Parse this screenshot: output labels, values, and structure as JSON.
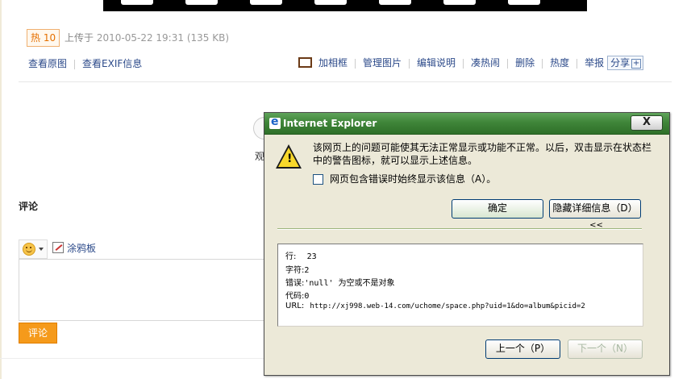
{
  "photo": {
    "hot_badge": "热 10",
    "upload_prefix": "上传于",
    "upload_time": "2010-05-22 19:31",
    "file_size": "(135 KB)"
  },
  "links_left": [
    "查看原图",
    "查看EXIF信息"
  ],
  "links_right": {
    "add_frame": "加相框",
    "manage": "管理图片",
    "edit_desc": "编辑说明",
    "join_hot": "凑热闹",
    "delete": "删除",
    "heat": "热度",
    "report": "举报",
    "share": "分享"
  },
  "background_text": "观",
  "comments": {
    "title": "评论",
    "doodle_label": "涂鸦板",
    "submit": "评论"
  },
  "dialog": {
    "title": "Internet Explorer",
    "close": "X",
    "message": "该网页上的问题可能使其无法正常显示或功能不正常。以后，双击显示在状态栏中的警告图标，就可以显示上述信息。",
    "checkbox_label": "网页包含错误时始终显示该信息（A）。",
    "ok_button": "确定",
    "hide_details_button": "隐藏详细信息（D）",
    "hide_details_chevron": "<<",
    "details": {
      "line_label": "行:",
      "line_value": "23",
      "char_label": "字符:",
      "char_value": "2",
      "error_label": "错误:",
      "error_value": "'null' 为空或不是对象",
      "code_label": "代码:",
      "code_value": "0",
      "url_label": "URL:",
      "url_value": "http://xj998.web-14.com/uchome/space.php?uid=1&do=album&picid=2"
    },
    "prev_button": "上一个（P）",
    "next_button": "下一个（N）"
  },
  "colors": {
    "title_bar": "#3f8539",
    "hot_badge": "#e57000",
    "link": "#2c4a8a",
    "submit": "#f59a1b"
  }
}
